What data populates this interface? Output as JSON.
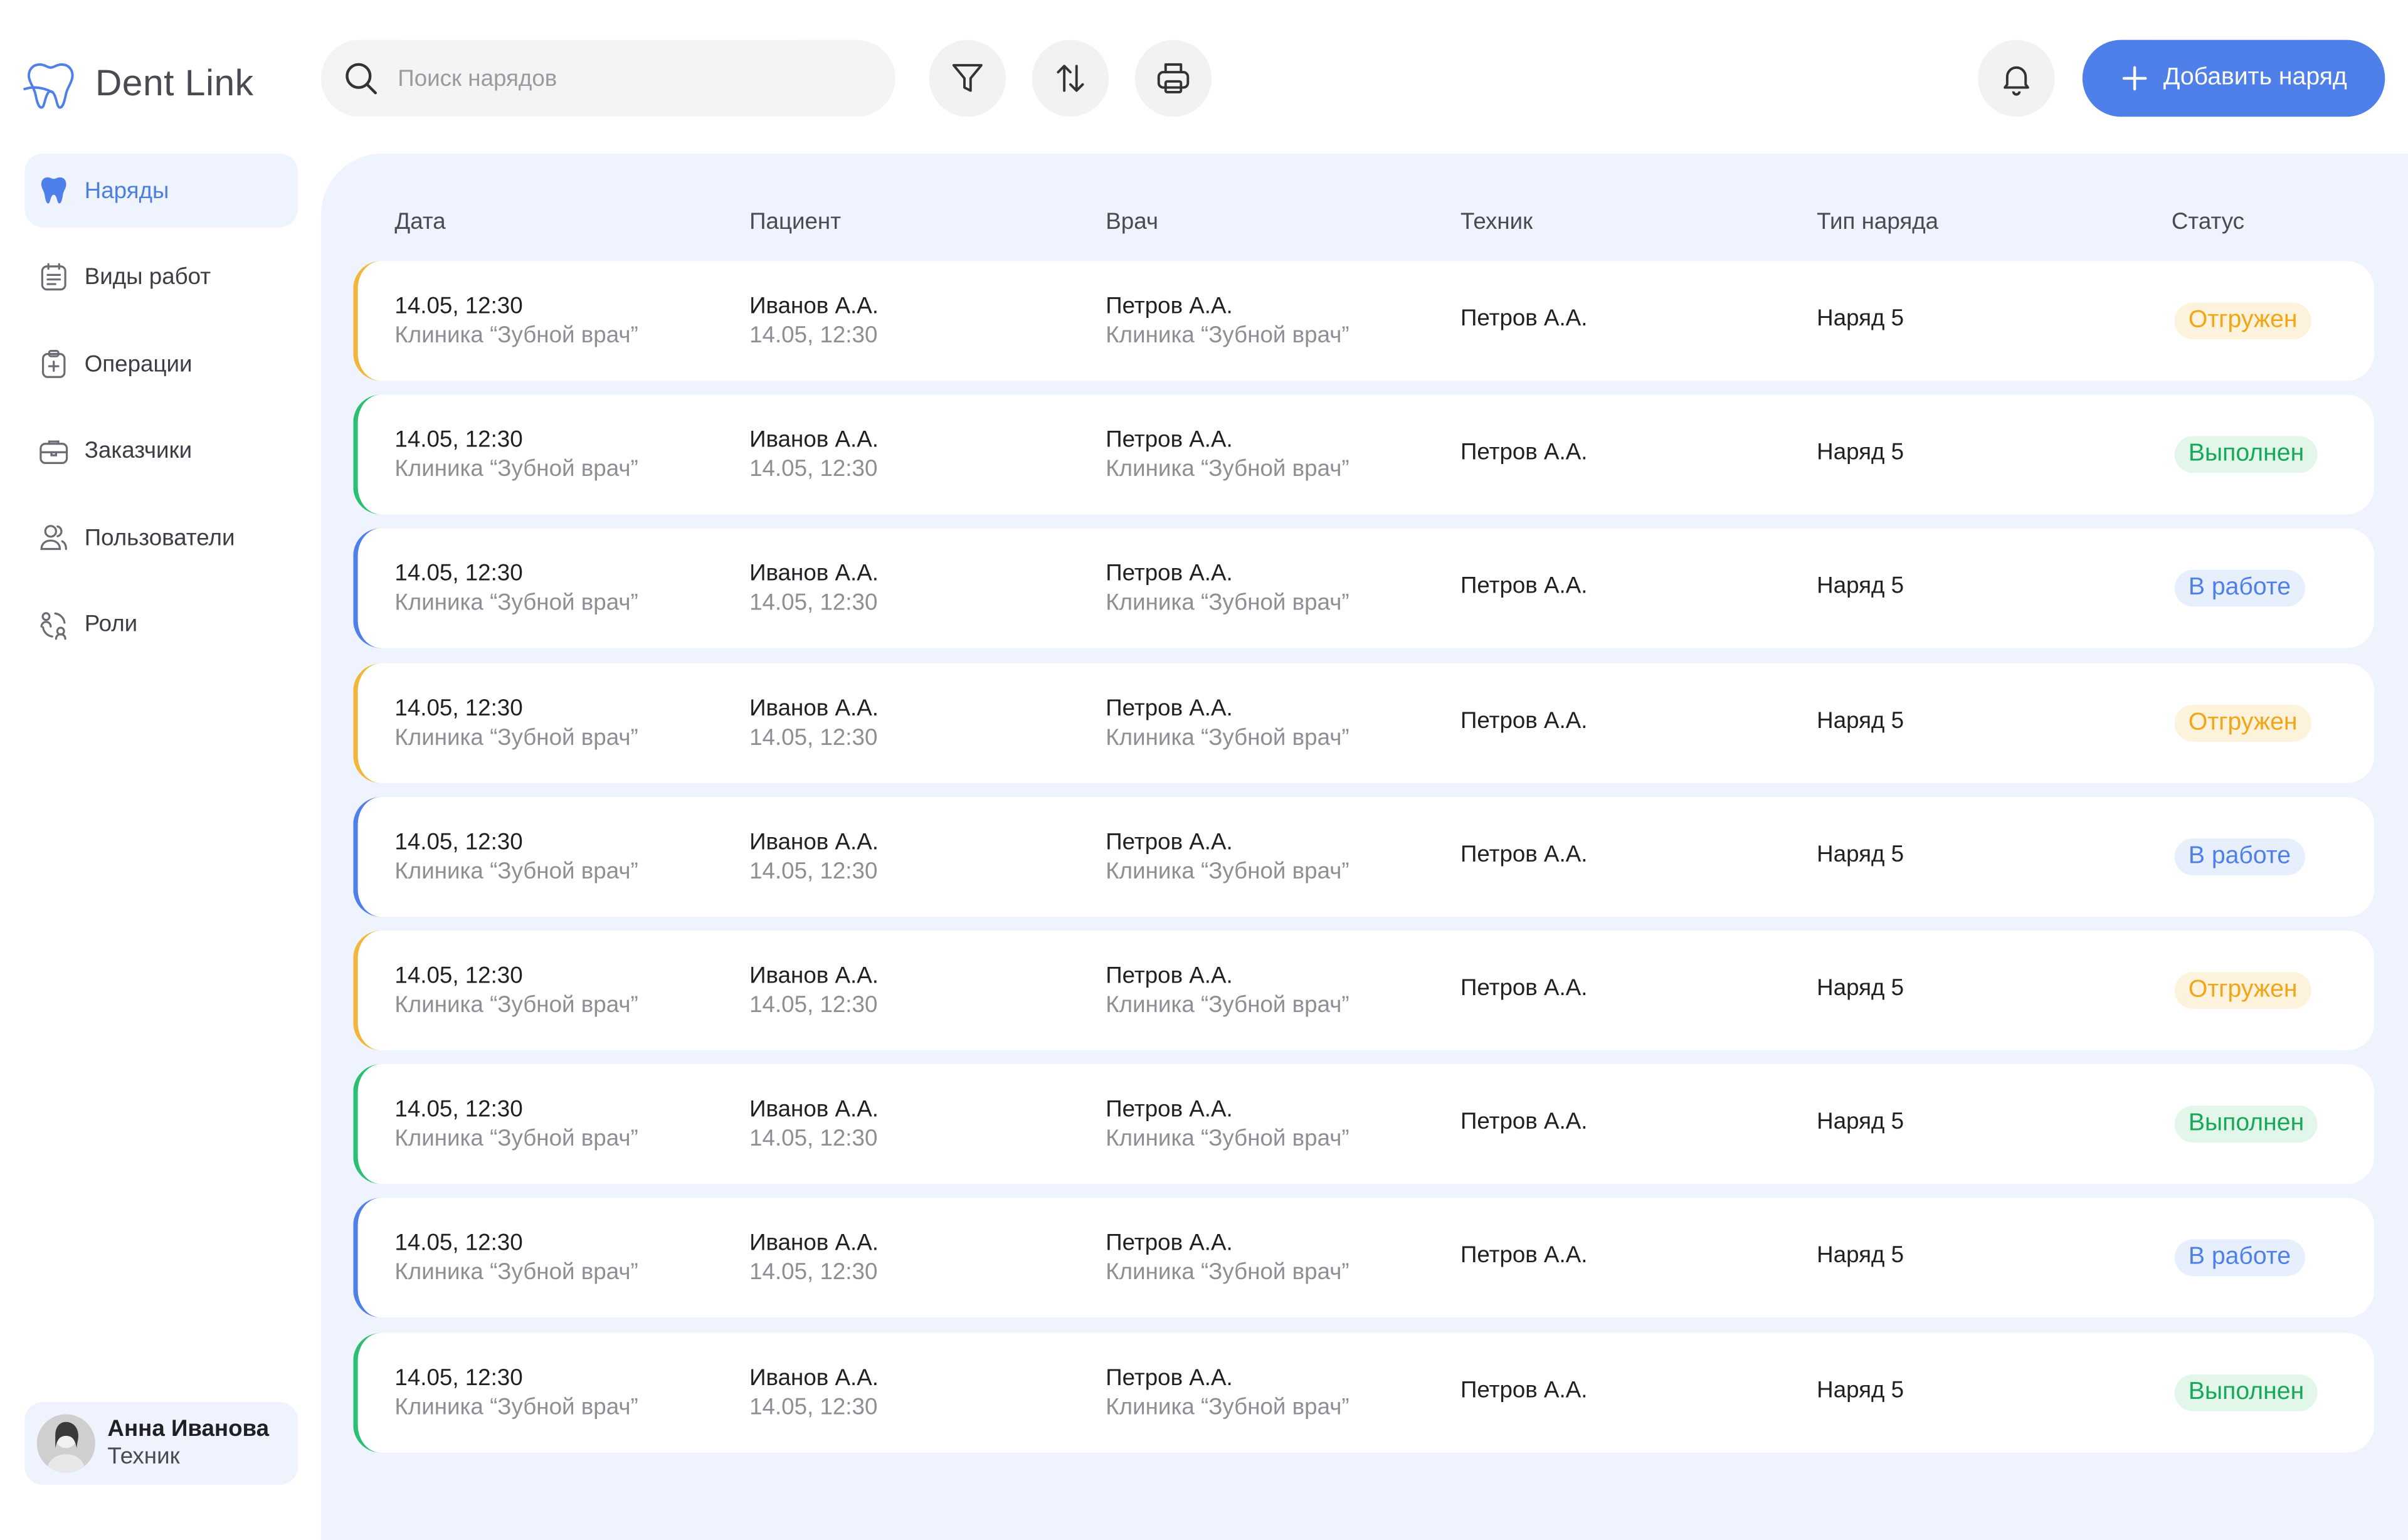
{
  "app": {
    "logo_text": "Dent Link"
  },
  "sidebar": {
    "items": [
      {
        "label": "Наряды",
        "icon": "tooth-icon",
        "active": true
      },
      {
        "label": "Виды работ",
        "icon": "list-icon",
        "active": false
      },
      {
        "label": "Операции",
        "icon": "clipboard-plus-icon",
        "active": false
      },
      {
        "label": "Заказчики",
        "icon": "briefcase-icon",
        "active": false
      },
      {
        "label": "Пользователи",
        "icon": "users-icon",
        "active": false
      },
      {
        "label": "Роли",
        "icon": "roles-icon",
        "active": false
      }
    ]
  },
  "user": {
    "name": "Анна Иванова",
    "role": "Техник"
  },
  "toolbar": {
    "search_placeholder": "Поиск нарядов",
    "search_value": "",
    "add_label": "Добавить наряд",
    "icons": [
      "filter-icon",
      "sort-icon",
      "print-icon",
      "bell-icon"
    ]
  },
  "table": {
    "columns": [
      "Дата",
      "Пациент",
      "Врач",
      "Техник",
      "Тип наряда",
      "Статус"
    ],
    "rows": [
      {
        "date": "14.05, 12:30",
        "clinic": "Клиника “Зубной врач”",
        "patient": "Иванов А.А.",
        "patient_date": "14.05, 12:30",
        "doctor": "Петров А.А.",
        "doctor_clinic": "Клиника “Зубной врач”",
        "technician": "Петров А.А.",
        "type": "Наряд 5",
        "status": "Отгружен",
        "status_key": "shipped"
      },
      {
        "date": "14.05, 12:30",
        "clinic": "Клиника “Зубной врач”",
        "patient": "Иванов А.А.",
        "patient_date": "14.05, 12:30",
        "doctor": "Петров А.А.",
        "doctor_clinic": "Клиника “Зубной врач”",
        "technician": "Петров А.А.",
        "type": "Наряд 5",
        "status": "Выполнен",
        "status_key": "done"
      },
      {
        "date": "14.05, 12:30",
        "clinic": "Клиника “Зубной врач”",
        "patient": "Иванов А.А.",
        "patient_date": "14.05, 12:30",
        "doctor": "Петров А.А.",
        "doctor_clinic": "Клиника “Зубной врач”",
        "technician": "Петров А.А.",
        "type": "Наряд 5",
        "status": "В работе",
        "status_key": "progress"
      },
      {
        "date": "14.05, 12:30",
        "clinic": "Клиника “Зубной врач”",
        "patient": "Иванов А.А.",
        "patient_date": "14.05, 12:30",
        "doctor": "Петров А.А.",
        "doctor_clinic": "Клиника “Зубной врач”",
        "technician": "Петров А.А.",
        "type": "Наряд 5",
        "status": "Отгружен",
        "status_key": "shipped"
      },
      {
        "date": "14.05, 12:30",
        "clinic": "Клиника “Зубной врач”",
        "patient": "Иванов А.А.",
        "patient_date": "14.05, 12:30",
        "doctor": "Петров А.А.",
        "doctor_clinic": "Клиника “Зубной врач”",
        "technician": "Петров А.А.",
        "type": "Наряд 5",
        "status": "В работе",
        "status_key": "progress"
      },
      {
        "date": "14.05, 12:30",
        "clinic": "Клиника “Зубной врач”",
        "patient": "Иванов А.А.",
        "patient_date": "14.05, 12:30",
        "doctor": "Петров А.А.",
        "doctor_clinic": "Клиника “Зубной врач”",
        "technician": "Петров А.А.",
        "type": "Наряд 5",
        "status": "Отгружен",
        "status_key": "shipped"
      },
      {
        "date": "14.05, 12:30",
        "clinic": "Клиника “Зубной врач”",
        "patient": "Иванов А.А.",
        "patient_date": "14.05, 12:30",
        "doctor": "Петров А.А.",
        "doctor_clinic": "Клиника “Зубной врач”",
        "technician": "Петров А.А.",
        "type": "Наряд 5",
        "status": "Выполнен",
        "status_key": "done"
      },
      {
        "date": "14.05, 12:30",
        "clinic": "Клиника “Зубной врач”",
        "patient": "Иванов А.А.",
        "patient_date": "14.05, 12:30",
        "doctor": "Петров А.А.",
        "doctor_clinic": "Клиника “Зубной врач”",
        "technician": "Петров А.А.",
        "type": "Наряд 5",
        "status": "В работе",
        "status_key": "progress"
      },
      {
        "date": "14.05, 12:30",
        "clinic": "Клиника “Зубной врач”",
        "patient": "Иванов А.А.",
        "patient_date": "14.05, 12:30",
        "doctor": "Петров А.А.",
        "doctor_clinic": "Клиника “Зубной врач”",
        "technician": "Петров А.А.",
        "type": "Наряд 5",
        "status": "Выполнен",
        "status_key": "done"
      }
    ]
  },
  "colors": {
    "accent": "#4f80ea",
    "shipped_text": "#f2a516",
    "shipped_bg": "#fdf3dc",
    "shipped_bar": "#f0b73a",
    "done_text": "#18a85a",
    "done_bg": "#e2f6ea",
    "done_bar": "#2bbf72",
    "progress_text": "#4f80ea",
    "progress_bg": "#e8effc",
    "progress_bar": "#4f80ea"
  }
}
